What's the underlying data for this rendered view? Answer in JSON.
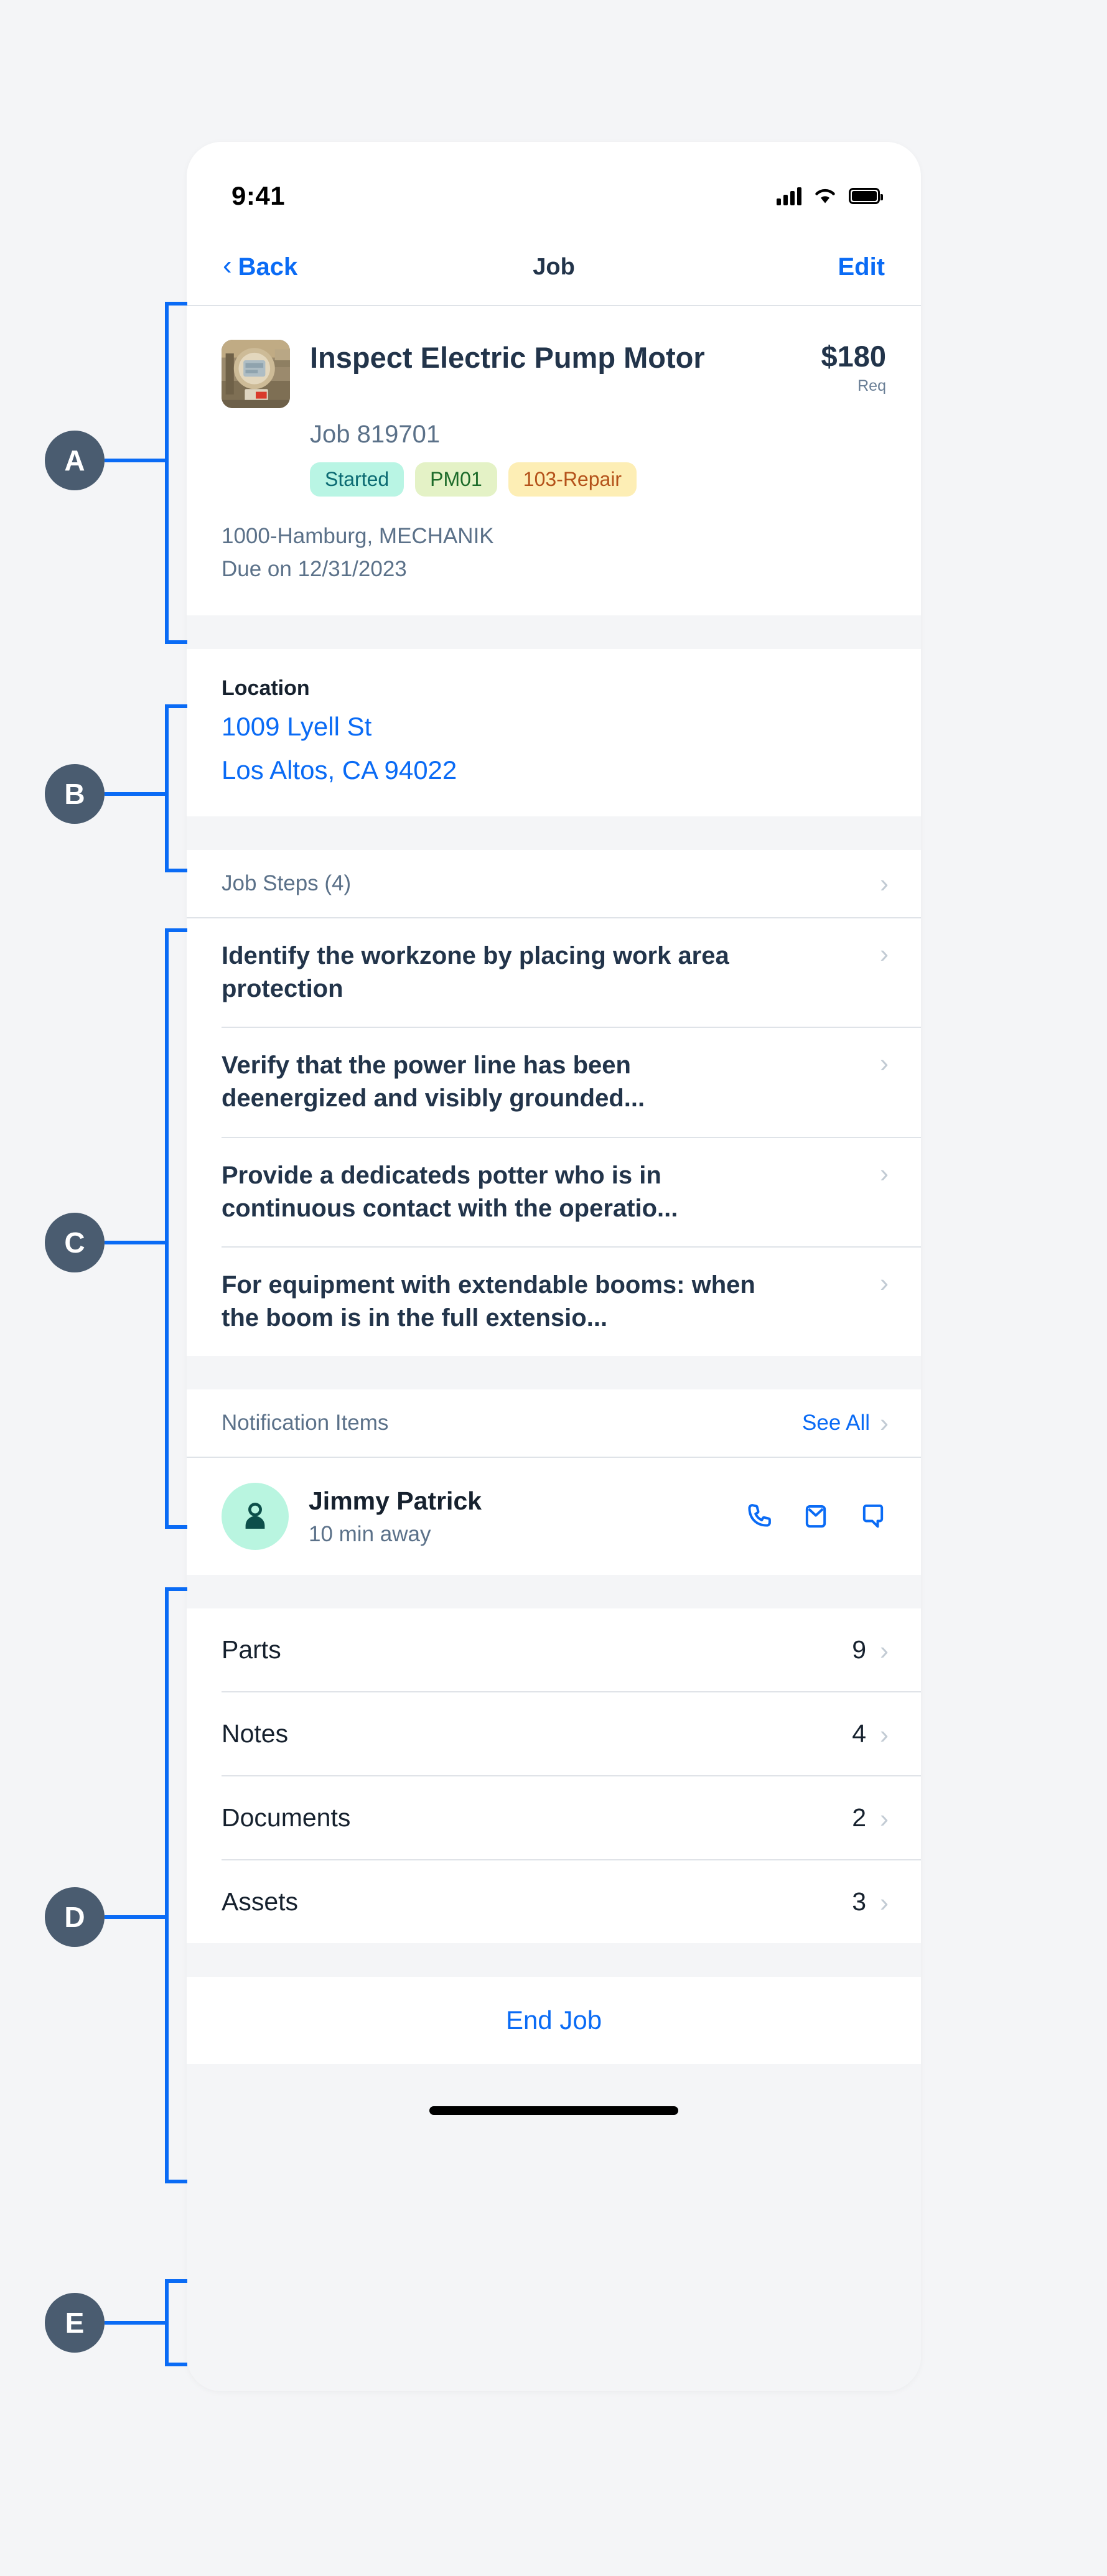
{
  "statusbar": {
    "time": "9:41",
    "signal_icon": "cellular-signal-icon",
    "wifi_icon": "wifi-icon",
    "battery_icon": "battery-icon"
  },
  "navbar": {
    "back_label": "Back",
    "title": "Job",
    "edit_label": "Edit"
  },
  "job": {
    "thumbnail_alt": "pressure-transmitter-photo",
    "title": "Inspect Electric Pump Motor",
    "price": "$180",
    "price_sub": "Req",
    "job_id": "Job 819701",
    "tags": [
      {
        "label": "Started",
        "bg": "#b9f5e4",
        "fg": "#0c6b73"
      },
      {
        "label": "PM01",
        "bg": "#e4f2c6",
        "fg": "#1d6b2a"
      },
      {
        "label": "103-Repair",
        "bg": "#fdeeb5",
        "fg": "#b4521a"
      }
    ],
    "plant": "1000-Hamburg, MECHANIK",
    "due": "Due on 12/31/2023"
  },
  "location": {
    "label": "Location",
    "address_line1": "1009 Lyell St",
    "address_line2": "Los Altos, CA 94022"
  },
  "job_steps": {
    "header": "Job Steps (4)",
    "items": [
      "Identify the workzone by placing work area protection",
      "Verify that the power line has been deenergized and visibly grounded...",
      "Provide a dedicateds potter who is in continuous contact with the operatio...",
      "For equipment with extendable booms: when the boom is in the full extensio..."
    ]
  },
  "notifications": {
    "header": "Notification Items",
    "see_all": "See All",
    "contact": {
      "avatar_icon": "person-icon",
      "name": "Jimmy Patrick",
      "subtitle": "10 min away",
      "actions": [
        {
          "name": "phone-icon"
        },
        {
          "name": "email-icon"
        },
        {
          "name": "chat-icon"
        }
      ]
    }
  },
  "counts": [
    {
      "label": "Parts",
      "value": "9"
    },
    {
      "label": "Notes",
      "value": "4"
    },
    {
      "label": "Documents",
      "value": "2"
    },
    {
      "label": "Assets",
      "value": "3"
    }
  ],
  "footer": {
    "end_job": "End Job"
  },
  "annotations": [
    {
      "letter": "A"
    },
    {
      "letter": "B"
    },
    {
      "letter": "C"
    },
    {
      "letter": "D"
    },
    {
      "letter": "E"
    }
  ],
  "colors": {
    "accent_blue": "#0a6bf5",
    "text_dark": "#22344a",
    "text_muted": "#5b7189",
    "page_bg": "#f4f5f7",
    "badge_bg": "#4a5c70"
  }
}
